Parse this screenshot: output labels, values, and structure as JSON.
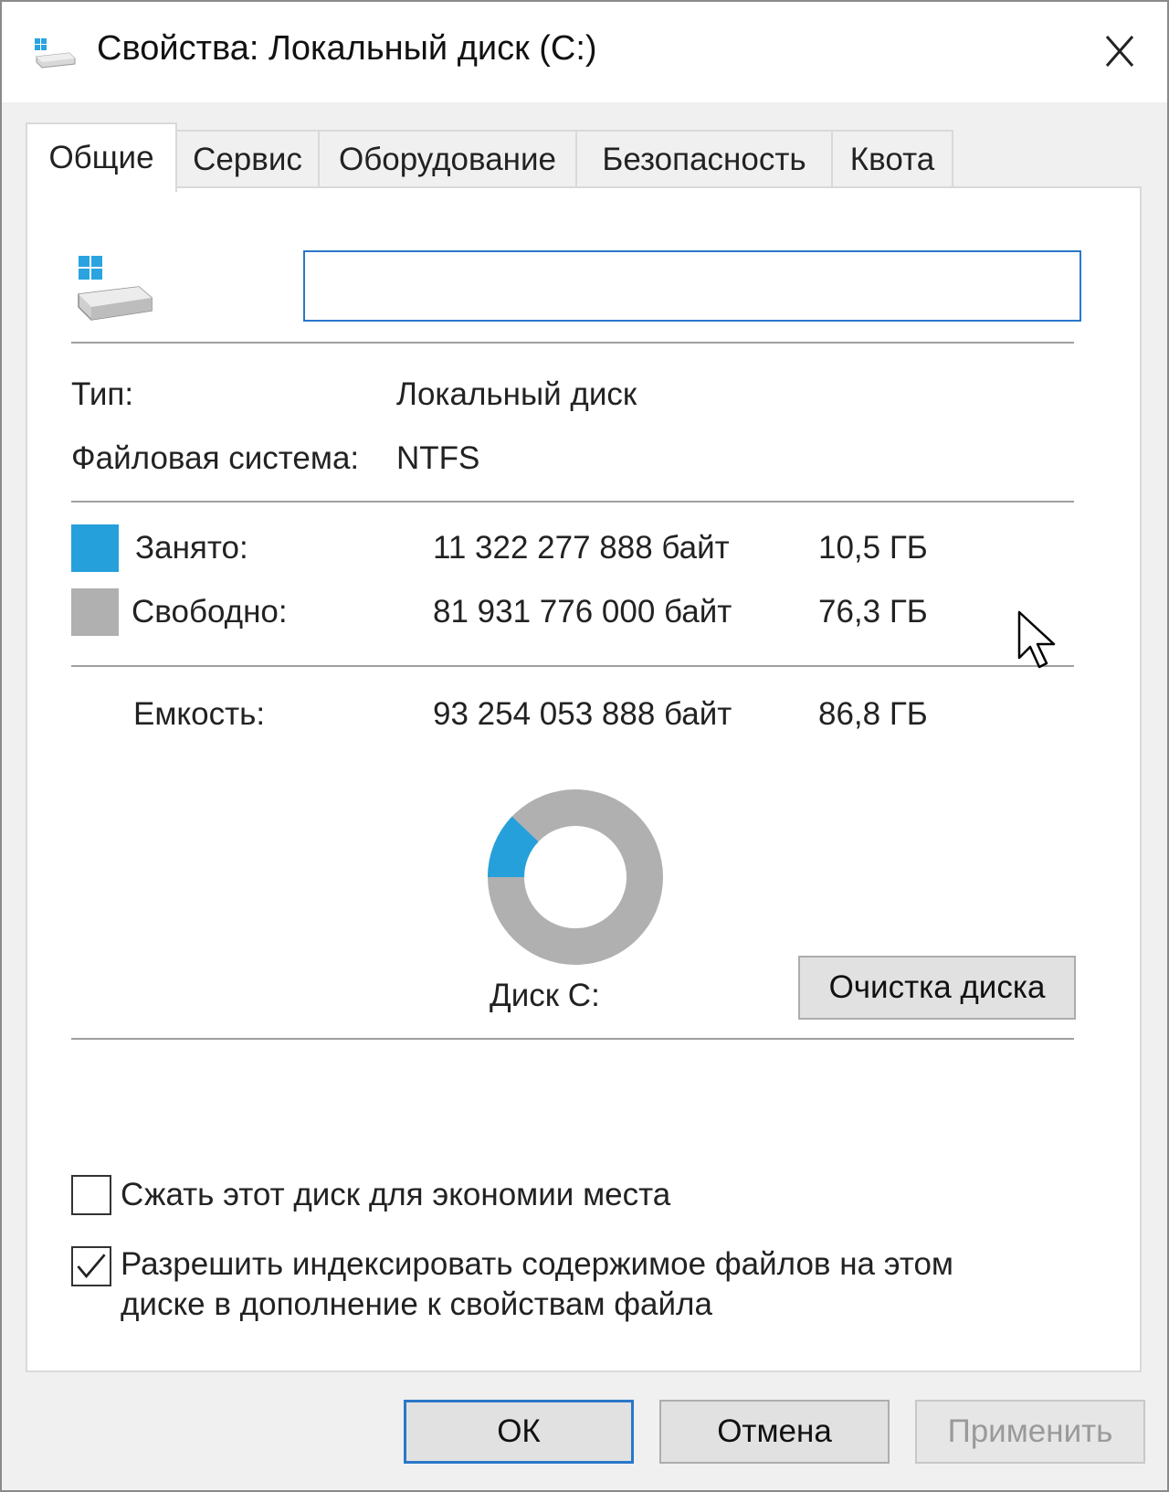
{
  "window": {
    "title": "Свойства: Локальный диск (C:)",
    "close_icon": "close-icon",
    "title_icon": "drive-icon"
  },
  "tabs": [
    {
      "label": "Общие",
      "active": true
    },
    {
      "label": "Сервис",
      "active": false
    },
    {
      "label": "Оборудование",
      "active": false
    },
    {
      "label": "Безопасность",
      "active": false
    },
    {
      "label": "Квота",
      "active": false
    }
  ],
  "general": {
    "volume_label_value": "",
    "type_label": "Тип:",
    "type_value": "Локальный диск",
    "fs_label": "Файловая система:",
    "fs_value": "NTFS",
    "used": {
      "label": "Занято:",
      "bytes": "11 322 277 888 байт",
      "size": "10,5 ГБ",
      "color": "#26a0da"
    },
    "free": {
      "label": "Свободно:",
      "bytes": "81 931 776 000 байт",
      "size": "76,3 ГБ",
      "color": "#b0b0b0"
    },
    "capacity": {
      "label": "Емкость:",
      "bytes": "93 254 053 888 байт",
      "size": "86,8 ГБ"
    },
    "used_fraction": 0.1214,
    "disk_label": "Диск C:",
    "cleanup_button": "Очистка диска",
    "compress_checkbox": {
      "label": "Сжать этот диск для экономии места",
      "checked": false
    },
    "index_checkbox": {
      "label_line1": "Разрешить индексировать содержимое файлов на этом",
      "label_line2": "диске в дополнение к свойствам файла",
      "checked": true
    }
  },
  "footer": {
    "ok": "ОК",
    "cancel": "Отмена",
    "apply": "Применить",
    "apply_disabled": true
  },
  "accent_color": "#2a78c8"
}
